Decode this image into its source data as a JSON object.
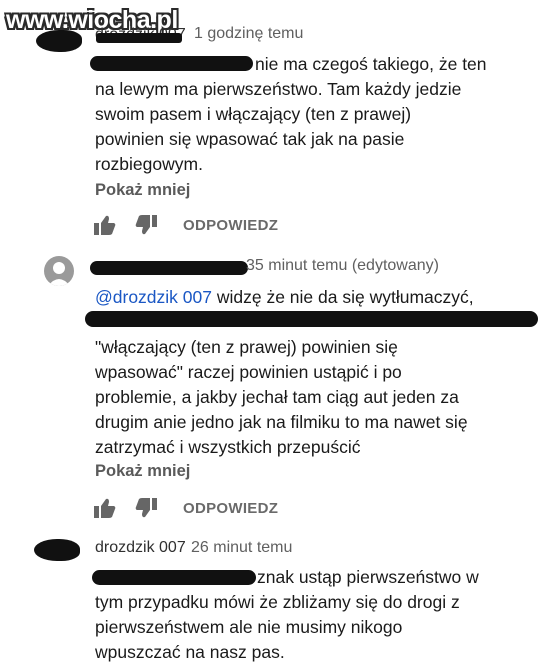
{
  "watermark": "www.wiocha.pl",
  "comments": [
    {
      "author": "drozdzik 007",
      "time": "1 godzinę temu",
      "lines": [
        "nie ma czegoś takiego, że ten",
        "na lewym ma pierwszeństwo. Tam każdy jedzie",
        "swoim pasem i włączający (ten z prawej)",
        "powinien się wpasować tak jak na pasie",
        "rozbiegowym."
      ],
      "show_less": "Pokaż mniej",
      "reply": "ODPOWIEDZ"
    },
    {
      "time": "35 minut temu (edytowany)",
      "mention": "@drozdzik 007",
      "first_line_rest": " widzę że nie da się wytłumaczyć,",
      "lines": [
        "\"włączający (ten z prawej) powinien się",
        "wpasować\" raczej powinien ustąpić i po",
        "problemie, a jakby jechał tam ciąg aut jeden za",
        "drugim anie jedno jak na filmiku to ma nawet się",
        "zatrzymać i wszystkich przepuścić"
      ],
      "show_less": "Pokaż mniej",
      "reply": "ODPOWIEDZ"
    },
    {
      "author": "drozdzik 007",
      "time": "26 minut temu",
      "lines": [
        "znak ustąp pierwszeństwo w",
        "tym przypadku mówi że zbliżamy się do drogi z",
        "pierwszeństwem ale nie musimy nikogo",
        "wpuszczać na nasz pas."
      ]
    }
  ],
  "icons": {
    "like": "thumbs-up-icon",
    "dislike": "thumbs-down-icon"
  },
  "colors": {
    "mention": "#1a57c4",
    "meta": "#606060",
    "reply": "#6a6a6a"
  }
}
